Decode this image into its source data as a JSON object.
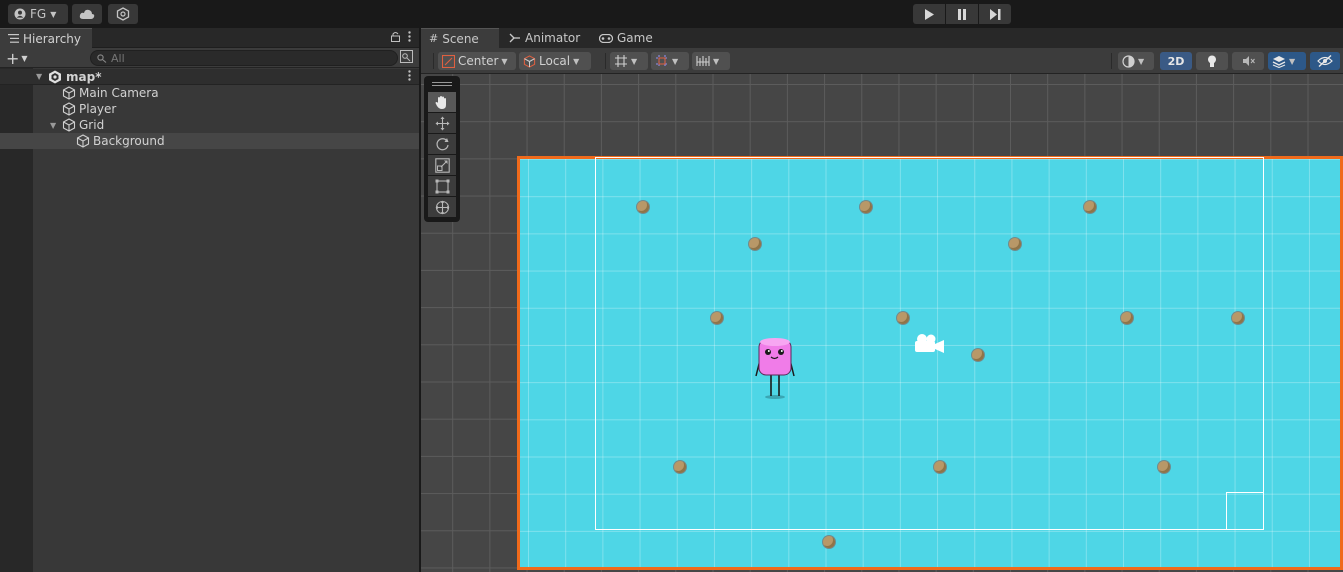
{
  "toolbar": {
    "account_label": "FG",
    "cloud_icon": "cloud-icon",
    "collab_icon": "collab-icon",
    "play_icons": [
      "play-icon",
      "pause-icon",
      "step-icon"
    ]
  },
  "hierarchy": {
    "tab_label": "Hierarchy",
    "search_placeholder": "All",
    "scene": {
      "name": "map*"
    },
    "items": [
      {
        "label": "Main Camera",
        "depth": 1,
        "expandable": false,
        "selected": false
      },
      {
        "label": "Player",
        "depth": 1,
        "expandable": false,
        "selected": false
      },
      {
        "label": "Grid",
        "depth": 1,
        "expandable": true,
        "selected": false
      },
      {
        "label": "Background",
        "depth": 2,
        "expandable": false,
        "selected": true
      }
    ]
  },
  "scene_view": {
    "tabs": [
      {
        "label": "Scene",
        "icon": "grid-hash-icon",
        "active": true
      },
      {
        "label": "Animator",
        "icon": "animator-icon",
        "active": false
      },
      {
        "label": "Game",
        "icon": "gamepad-icon",
        "active": false
      }
    ],
    "pivot_mode": "Center",
    "pivot_rotation": "Local",
    "mode_2d_label": "2D",
    "tools": [
      "hand-tool-icon",
      "move-tool-icon",
      "rotate-tool-icon",
      "scale-tool-icon",
      "rect-tool-icon",
      "transform-tool-icon"
    ],
    "active_tool": "hand-tool-icon"
  },
  "colors": {
    "background_fill": "#4ed6e6",
    "selection_outline": "#ef6a1b",
    "character": "#f07ce8",
    "accent_blue": "#3a5a85"
  }
}
